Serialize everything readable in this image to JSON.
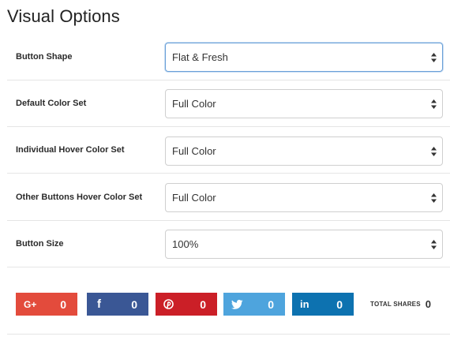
{
  "section": {
    "title": "Visual Options"
  },
  "options": [
    {
      "label": "Button Shape",
      "value": "Flat & Fresh"
    },
    {
      "label": "Default Color Set",
      "value": "Full Color"
    },
    {
      "label": "Individual Hover Color Set",
      "value": "Full Color"
    },
    {
      "label": "Other Buttons Hover Color Set",
      "value": "Full Color"
    },
    {
      "label": "Button Size",
      "value": "100%"
    }
  ],
  "share_buttons": [
    {
      "network": "google-plus",
      "icon_text": "G+",
      "count": "0",
      "color": "#e34b3c"
    },
    {
      "network": "facebook",
      "icon_text": "f",
      "count": "0",
      "color": "#3a5795"
    },
    {
      "network": "pinterest",
      "icon_text": "",
      "count": "0",
      "color": "#cb1f27"
    },
    {
      "network": "twitter",
      "icon_text": "",
      "count": "0",
      "color": "#4ea4dd"
    },
    {
      "network": "linkedin",
      "icon_text": "in",
      "count": "0",
      "color": "#0d72b0"
    }
  ],
  "total_shares": {
    "label": "TOTAL SHARES",
    "count": "0"
  }
}
